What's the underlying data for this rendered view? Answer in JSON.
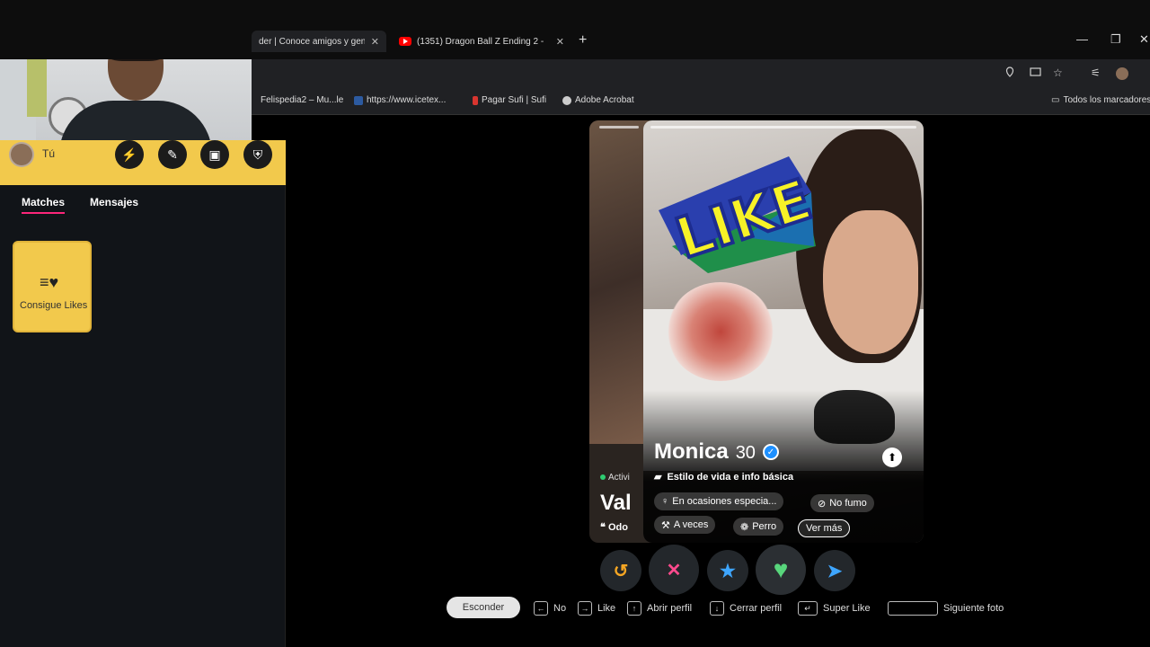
{
  "browser": {
    "tab1_title": "der | Conoce amigos y gent",
    "tab2_title": "(1351) Dragon Ball Z Ending 2 -",
    "tab_close": "✕",
    "new_tab": "+",
    "minimize": "—",
    "restore": "❐",
    "close": "✕",
    "bookmarks": [
      "Felispedia2 – Mu...le",
      "https://www.icetex...",
      "Pagar Sufi | Sufi",
      "Adobe Acrobat"
    ],
    "bookmarks_all": "Todos los marcadores"
  },
  "sidebar": {
    "me_label": "Tú",
    "tabs": [
      "Matches",
      "Mensajes"
    ],
    "likes_card": "Consigue Likes"
  },
  "back_card": {
    "active": "Activi",
    "name": "Val",
    "quote": "Odo"
  },
  "profile": {
    "name": "Monica",
    "age": "30",
    "info": "Estilo de vida e info básica",
    "chips": [
      "En ocasiones especia...",
      "No fumo",
      "A veces",
      "Perro",
      "Ver más"
    ],
    "overlay_stamp": "LIKE"
  },
  "actions": {
    "rewind": "↺",
    "nope": "✕",
    "superlike": "★",
    "like": "♥",
    "boost": "➤"
  },
  "shortcuts": {
    "hide": "Esconder",
    "items": [
      {
        "key": "←",
        "label": "No"
      },
      {
        "key": "→",
        "label": "Like"
      },
      {
        "key": "↑",
        "label": "Abrir perfil"
      },
      {
        "key": "↓",
        "label": "Cerrar perfil"
      },
      {
        "key": "↵",
        "label": "Super Like"
      },
      {
        "key": "",
        "label": "Siguiente foto"
      }
    ]
  },
  "colors": {
    "accent_yellow": "#f2c94c",
    "tinder_pink": "#fd267a",
    "like_green": "#58d67c",
    "nope_pink": "#ff4a8d",
    "superlike_blue": "#3ea6ff",
    "rewind_orange": "#f5a623",
    "boost_blue": "#3ea6ff"
  }
}
